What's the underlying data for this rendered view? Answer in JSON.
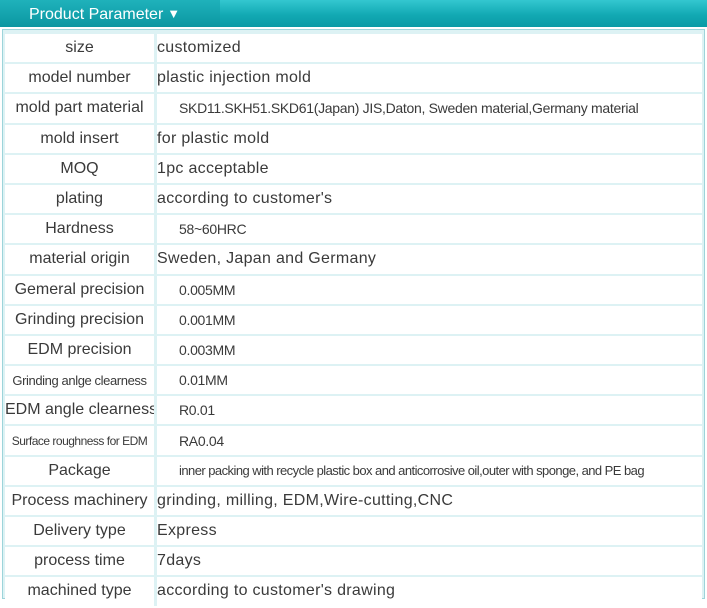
{
  "header": {
    "title": "Product Parameter",
    "arrow": "▼"
  },
  "rows": [
    {
      "label": "size",
      "value": "customized"
    },
    {
      "label": "model number",
      "value": "plastic injection mold"
    },
    {
      "label": "mold part material",
      "value": "SKD11.SKH51.SKD61(Japan)   JIS,Daton, Sweden material,Germany material"
    },
    {
      "label": "mold insert",
      "value": "for plastic mold"
    },
    {
      "label": "MOQ",
      "value": "1pc acceptable"
    },
    {
      "label": "plating",
      "value": "according to customer's"
    },
    {
      "label": "Hardness",
      "value": "58~60HRC"
    },
    {
      "label": "material origin",
      "value": "Sweden, Japan and Germany"
    },
    {
      "label": "Gemeral precision",
      "value": "0.005MM"
    },
    {
      "label": "Grinding precision",
      "value": "0.001MM"
    },
    {
      "label": "EDM precision",
      "value": "0.003MM"
    },
    {
      "label": "Grinding anlge clearness",
      "value": "0.01MM"
    },
    {
      "label": "EDM angle clearness",
      "value": "R0.01"
    },
    {
      "label": "Surface roughness for EDM",
      "value": "RA0.04"
    },
    {
      "label": "Package",
      "value": "inner packing with recycle plastic box and anticorrosive oil,outer with sponge, and PE bag"
    },
    {
      "label": "Process machinery",
      "value": "grinding, milling, EDM,Wire-cutting,CNC"
    },
    {
      "label": "Delivery type",
      "value": "Express"
    },
    {
      "label": "process time",
      "value": "7days"
    },
    {
      "label": "machined type",
      "value": "according to customer's drawing"
    }
  ]
}
